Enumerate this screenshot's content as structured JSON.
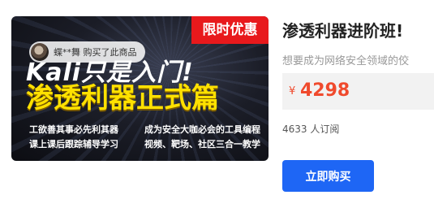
{
  "banner": {
    "tag": "限时优惠",
    "big_line": "Kali只是入门!",
    "main_title": "渗透利器正式篇",
    "features": [
      "工欲善其事必先利其器",
      "课上课后跟踪辅导学习",
      "成为安全大咖必会的工具编程",
      "视频、靶场、社区三合一教学"
    ],
    "notice": "蝶**舞 购买了此商品"
  },
  "course": {
    "title": "渗透利器进阶班!",
    "subtitle": "想要成为网络安全领域的佼",
    "currency": "¥",
    "price": "4298",
    "subscribers": "4633 人订阅",
    "buy_label": "立即购买"
  }
}
